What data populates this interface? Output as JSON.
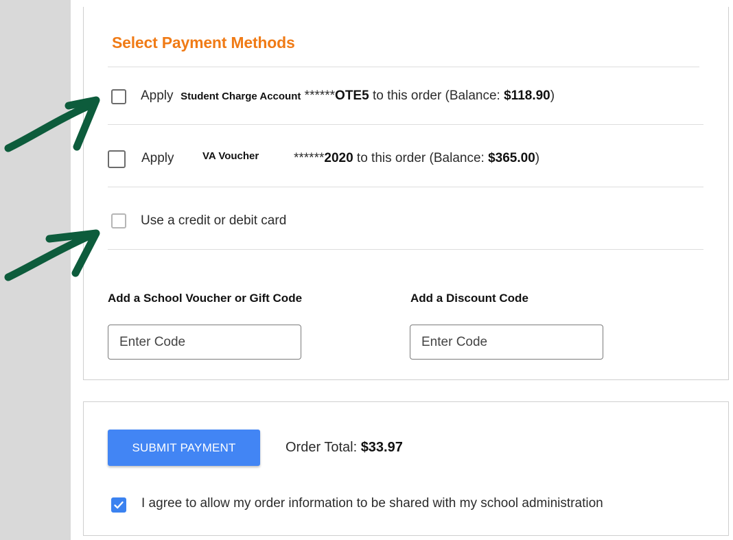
{
  "payment_methods": {
    "title": "Select Payment Methods",
    "accent_color": "#f07b16",
    "options": [
      {
        "apply_label": "Apply",
        "account_name": "Student Charge Account",
        "masked_number_prefix": "******",
        "masked_number_suffix": "OTE5",
        "middle_text": " to this order (Balance: ",
        "balance": "$118.90",
        "closing": ")",
        "checked": false
      },
      {
        "apply_label": "Apply",
        "account_name": "VA Voucher",
        "masked_number_prefix": "******",
        "masked_number_suffix": "2020",
        "middle_text": " to this order (Balance: ",
        "balance": "$365.00",
        "closing": ")",
        "checked": false
      }
    ],
    "card_option": {
      "label": "Use a credit or debit card",
      "checked": false
    }
  },
  "codes": {
    "voucher_label": "Add a School Voucher or Gift Code",
    "voucher_placeholder": "Enter Code",
    "discount_label": "Add a Discount Code",
    "discount_placeholder": "Enter Code"
  },
  "checkout": {
    "submit_label": "SUBMIT PAYMENT",
    "order_total_label": "Order Total: ",
    "order_total_value": "$33.97",
    "agree_label": "I agree to allow my order information to be shared with my school administration",
    "agree_checked": true,
    "button_color": "#4285f4"
  },
  "annotations": {
    "arrow_color": "#0d5c3c",
    "arrow_icon": "arrow-icon"
  }
}
